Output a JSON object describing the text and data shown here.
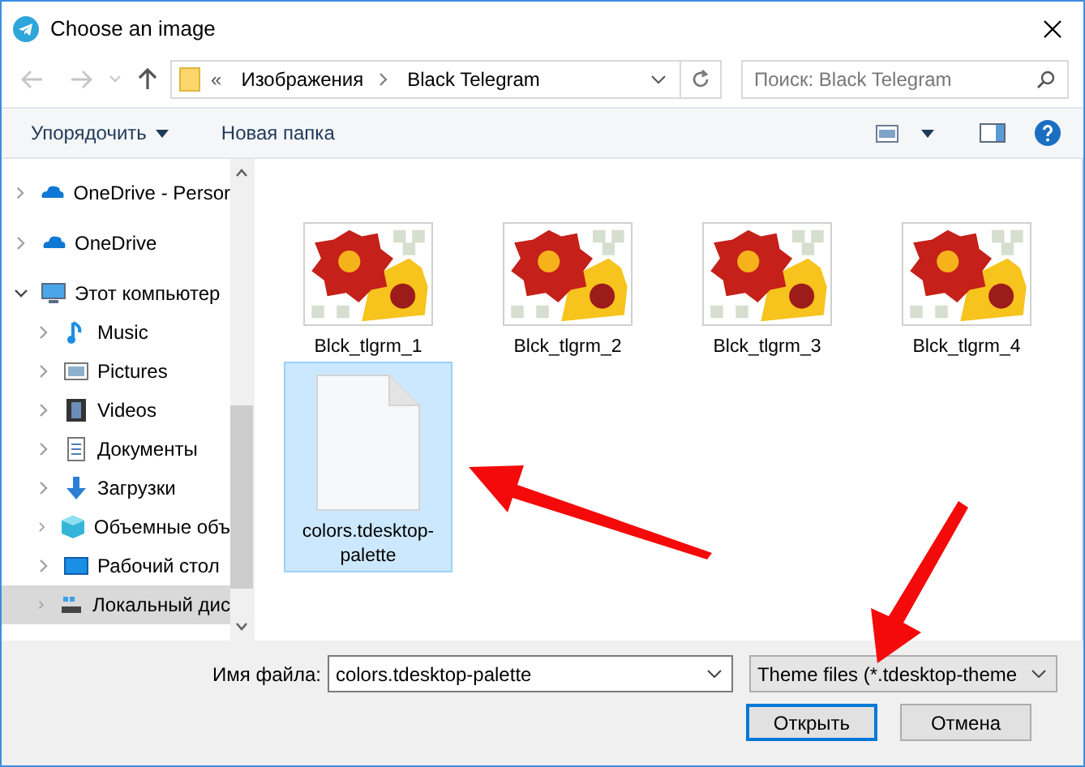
{
  "window": {
    "title": "Choose an image"
  },
  "address": {
    "overflow": "«",
    "crumbs": [
      "Изображения",
      "Black Telegram"
    ]
  },
  "search": {
    "placeholder": "Поиск: Black Telegram"
  },
  "toolbar": {
    "organize": "Упорядочить",
    "new_folder": "Новая папка"
  },
  "sidebar": {
    "items": [
      {
        "label": "OneDrive - Persor",
        "kind": "cloud",
        "expanded": false,
        "selected": false
      },
      {
        "label": "OneDrive",
        "kind": "cloud",
        "expanded": false,
        "selected": false
      },
      {
        "label": "Этот компьютер",
        "kind": "computer",
        "expanded": true,
        "selected": false,
        "children": [
          {
            "label": "Music",
            "kind": "music",
            "expanded": false,
            "selected": false
          },
          {
            "label": "Pictures",
            "kind": "pictures",
            "expanded": false,
            "selected": false
          },
          {
            "label": "Videos",
            "kind": "videos",
            "expanded": false,
            "selected": false
          },
          {
            "label": "Документы",
            "kind": "documents",
            "expanded": false,
            "selected": false
          },
          {
            "label": "Загрузки",
            "kind": "downloads",
            "expanded": false,
            "selected": false
          },
          {
            "label": "Объемные объ",
            "kind": "cube",
            "expanded": false,
            "selected": false
          },
          {
            "label": "Рабочий стол",
            "kind": "desktop",
            "expanded": false,
            "selected": false
          },
          {
            "label": "Локальный дис",
            "kind": "drive",
            "expanded": false,
            "selected": true
          }
        ]
      }
    ]
  },
  "files": [
    {
      "name": "Blck_tlgrm_1",
      "kind": "picture",
      "selected": false
    },
    {
      "name": "Blck_tlgrm_2",
      "kind": "picture",
      "selected": false
    },
    {
      "name": "Blck_tlgrm_3",
      "kind": "picture",
      "selected": false
    },
    {
      "name": "Blck_tlgrm_4",
      "kind": "picture",
      "selected": false
    },
    {
      "name": "colors.tdesktop-palette",
      "kind": "file",
      "selected": true
    }
  ],
  "filename": {
    "label": "Имя файла:",
    "value": "colors.tdesktop-palette"
  },
  "filter": {
    "value": "Theme files (*.tdesktop-theme"
  },
  "buttons": [
    {
      "label": "Открыть",
      "default": true
    },
    {
      "label": "Отмена",
      "default": false
    }
  ]
}
